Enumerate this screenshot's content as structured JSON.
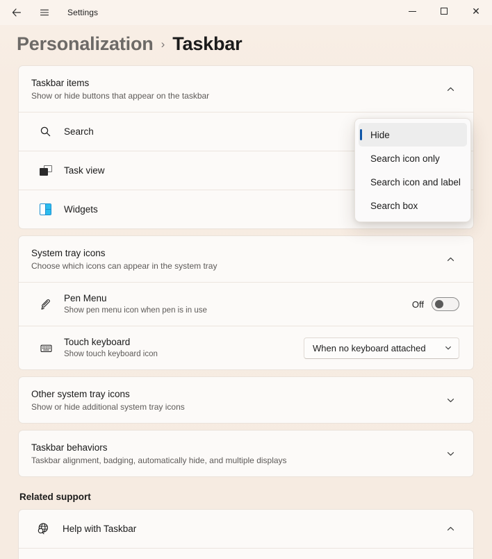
{
  "window": {
    "title": "Settings",
    "back_icon": "back-arrow-icon",
    "menu_icon": "hamburger-menu-icon",
    "minimize_label": "Minimize",
    "maximize_label": "Maximize",
    "close_label": "Close"
  },
  "breadcrumb": {
    "parent": "Personalization",
    "separator": "›",
    "current": "Taskbar"
  },
  "colors": {
    "page_background": "#f7ece2",
    "card_background": "#fcfaf8",
    "accent_selection": "#0f56a8",
    "widgets_icon": "#2bbced"
  },
  "sections": {
    "taskbar_items": {
      "title": "Taskbar items",
      "subtitle": "Show or hide buttons that appear on the taskbar",
      "expanded": true,
      "chevron": "chevron-up-icon",
      "rows": [
        {
          "label": "Search",
          "icon": "search-icon"
        },
        {
          "label": "Task view",
          "icon": "task-view-icon"
        },
        {
          "label": "Widgets",
          "icon": "widgets-icon"
        }
      ]
    },
    "system_tray_icons": {
      "title": "System tray icons",
      "subtitle": "Choose which icons can appear in the system tray",
      "expanded": true,
      "chevron": "chevron-up-icon",
      "pen_menu": {
        "title": "Pen Menu",
        "subtitle": "Show pen menu icon when pen is in use",
        "icon": "pen-icon",
        "toggle_label": "Off",
        "toggle_state": "off"
      },
      "touch_keyboard": {
        "title": "Touch keyboard",
        "subtitle": "Show touch keyboard icon",
        "icon": "keyboard-icon",
        "selected_option": "When no keyboard attached",
        "chevron": "chevron-down-icon"
      }
    },
    "other_system_tray_icons": {
      "title": "Other system tray icons",
      "subtitle": "Show or hide additional system tray icons",
      "expanded": false,
      "chevron": "chevron-down-icon"
    },
    "taskbar_behaviors": {
      "title": "Taskbar behaviors",
      "subtitle": "Taskbar alignment, badging, automatically hide, and multiple displays",
      "expanded": false,
      "chevron": "chevron-down-icon"
    }
  },
  "related_support": {
    "heading": "Related support",
    "help_item": {
      "label": "Help with Taskbar",
      "icon": "globe-search-icon",
      "chevron": "chevron-up-icon"
    }
  },
  "search_dropdown": {
    "open": true,
    "options": [
      {
        "label": "Hide",
        "selected": true
      },
      {
        "label": "Search icon only",
        "selected": false
      },
      {
        "label": "Search icon and label",
        "selected": false
      },
      {
        "label": "Search box",
        "selected": false
      }
    ]
  }
}
